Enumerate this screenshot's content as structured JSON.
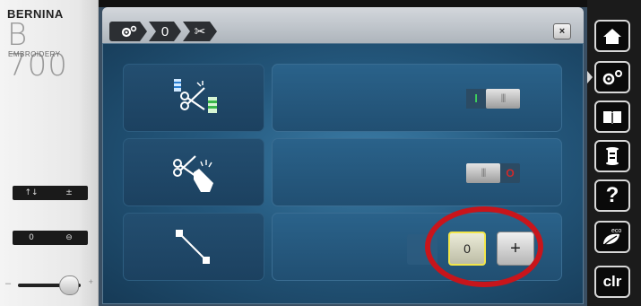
{
  "machine": {
    "brand": "BERNINA",
    "model": "B 700",
    "sub": "EMBROIDERY",
    "row1": {
      "left": "↑↓",
      "right": "±"
    },
    "row2": {
      "left": "0",
      "right": "⊖"
    },
    "slider_minus": "–",
    "slider_plus": "+"
  },
  "breadcrumb": {
    "items": [
      {
        "label": "⚙",
        "icon": "settings-icon"
      },
      {
        "label": "0",
        "icon": "zero-icon"
      },
      {
        "label": "✂",
        "icon": "scissors-icon"
      }
    ],
    "close_label": "×"
  },
  "settings": [
    {
      "name": "thread-cut-icon",
      "control": "toggle",
      "state": "on",
      "on_label": "I",
      "thumb_label": "|||"
    },
    {
      "name": "cut-touch-icon",
      "control": "toggle",
      "state": "off",
      "thumb_label": "|||",
      "off_label": "O"
    },
    {
      "name": "jump-stitch-icon",
      "control": "stepper",
      "value": "0",
      "plus_label": "+"
    }
  ],
  "sidebar": {
    "buttons": [
      {
        "name": "home-icon",
        "label": ""
      },
      {
        "name": "settings-icon",
        "label": ""
      },
      {
        "name": "book-icon",
        "label": ""
      },
      {
        "name": "bobbin-icon",
        "label": ""
      },
      {
        "name": "help-icon",
        "label": "?"
      },
      {
        "name": "eco-icon",
        "label": "eco"
      },
      {
        "name": "clr-icon",
        "label": "clr"
      }
    ]
  },
  "colors": {
    "accent_yellow": "#f2e64a",
    "highlight_red": "#c8151b",
    "toggle_on": "#3dd15b",
    "toggle_off": "#d02a2a"
  }
}
